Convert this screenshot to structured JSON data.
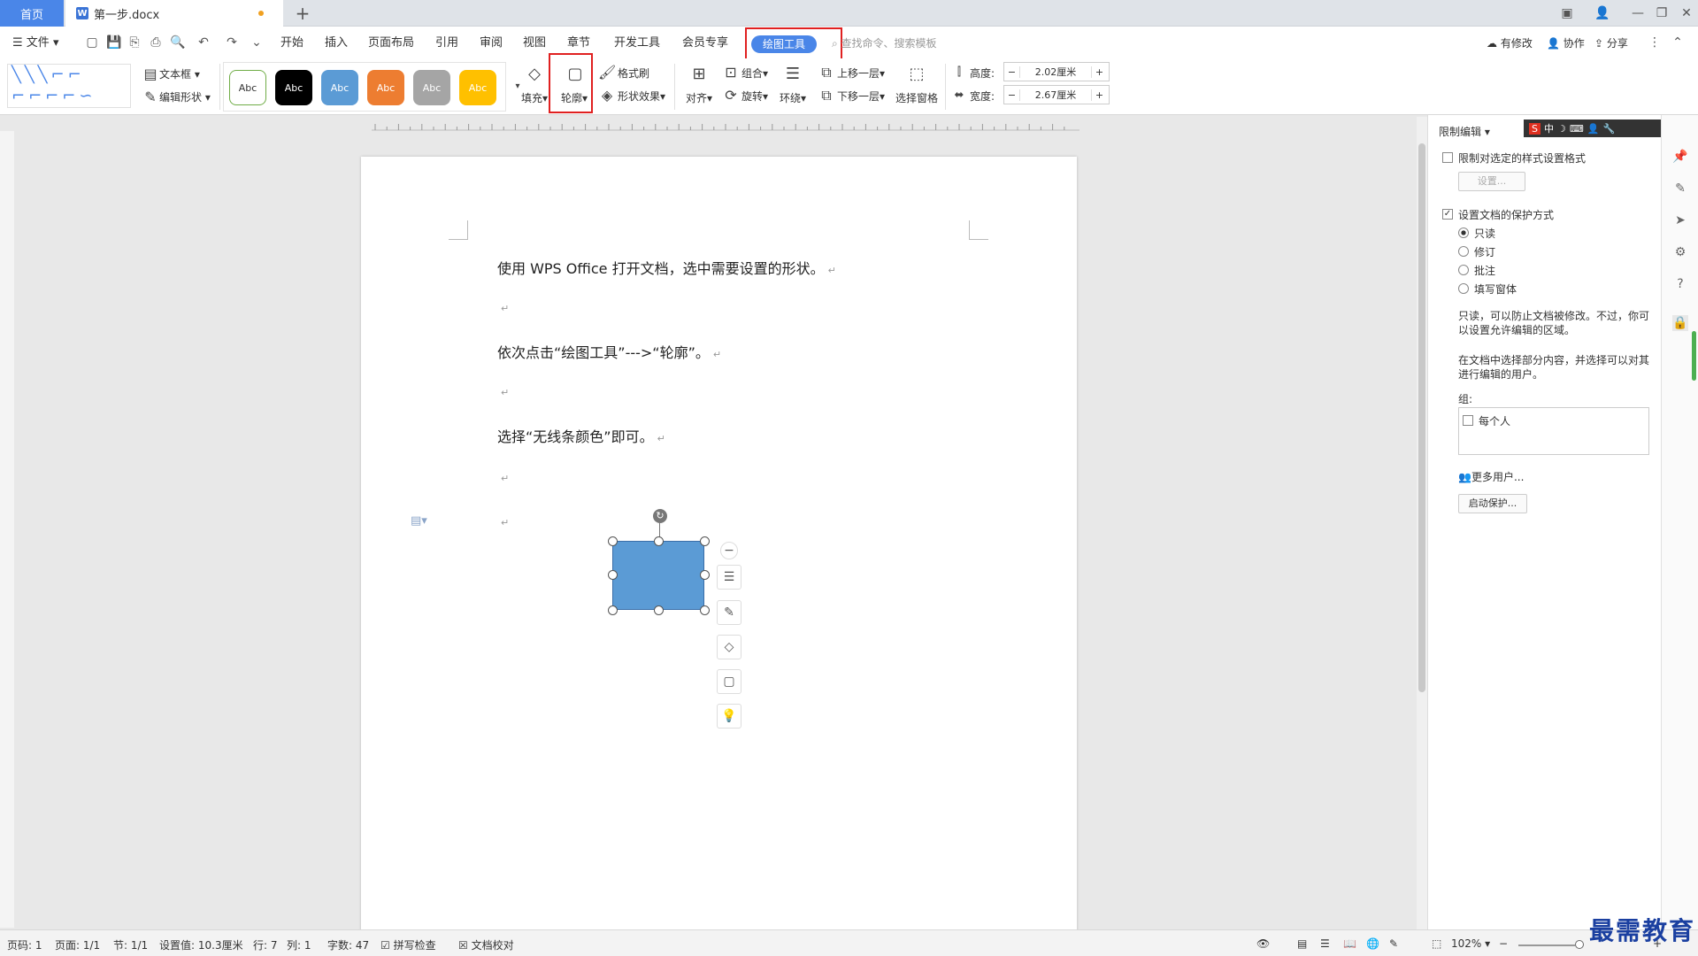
{
  "titlebar": {
    "home_tab": "首页",
    "doc_tab": "第一步.docx",
    "doc_icon": "W",
    "new_tab": "+"
  },
  "menu": {
    "file": "文件",
    "items": [
      "开始",
      "插入",
      "页面布局",
      "引用",
      "审阅",
      "视图",
      "章节",
      "开发工具",
      "会员专享"
    ],
    "active": "绘图工具",
    "search_placeholder": "查找命令、搜索模板",
    "right": [
      "有修改",
      "协作",
      "分享"
    ]
  },
  "ribbon": {
    "textbox": "文本框",
    "edit_shape": "编辑形状",
    "style_label": "Abc",
    "style_colors": [
      {
        "bg": "#ffffff",
        "border": "#70ad47",
        "fg": "#333333"
      },
      {
        "bg": "#000000",
        "border": "#000000",
        "fg": "#ffffff"
      },
      {
        "bg": "#5b9bd5",
        "border": "#5b9bd5",
        "fg": "#ffffff"
      },
      {
        "bg": "#ed7d31",
        "border": "#ed7d31",
        "fg": "#ffffff"
      },
      {
        "bg": "#a5a5a5",
        "border": "#a5a5a5",
        "fg": "#ffffff"
      },
      {
        "bg": "#ffc000",
        "border": "#ffc000",
        "fg": "#ffffff"
      }
    ],
    "fill": "填充",
    "outline": "轮廓",
    "format_painter": "格式刷",
    "shape_effect": "形状效果",
    "align": "对齐",
    "group": "组合",
    "rotate": "旋转",
    "wrap": "环绕",
    "bring_forward": "上移一层",
    "send_backward": "下移一层",
    "selection_pane": "选择窗格",
    "height_label": "高度:",
    "height_value": "2.02厘米",
    "width_label": "宽度:",
    "width_value": "2.67厘米"
  },
  "document": {
    "lines": [
      "使用 WPS Office 打开文档，选中需要设置的形状。",
      "依次点击“绘图工具”--->“轮廓”。",
      "选择“无线条颜色”即可。"
    ],
    "para_mark": "↵",
    "shape_color": "#5b9bd5"
  },
  "rightpanel": {
    "title": "限制编辑",
    "restrict_format": "限制对选定的样式设置格式",
    "settings_btn": "设置...",
    "protect_method": "设置文档的保护方式",
    "options": [
      "只读",
      "修订",
      "批注",
      "填写窗体"
    ],
    "desc1": "只读，可以防止文档被修改。不过，你可",
    "desc2": "以设置允许编辑的区域。",
    "desc3": "在文档中选择部分内容，并选择可以对其",
    "desc4": "进行编辑的用户。",
    "group_label": "组:",
    "everyone": "每个人",
    "more_users": "更多用户...",
    "start_protect": "启动保护..."
  },
  "ime": {
    "label": "中"
  },
  "status": {
    "page_code": "页码: 1",
    "page": "页面: 1/1",
    "section": "节: 1/1",
    "setting": "设置值: 10.3厘米",
    "row": "行: 7",
    "col": "列: 1",
    "words": "字数: 47",
    "spell": "拼写检查",
    "proof": "文档校对",
    "zoom": "102%"
  },
  "watermark": "最需教育"
}
